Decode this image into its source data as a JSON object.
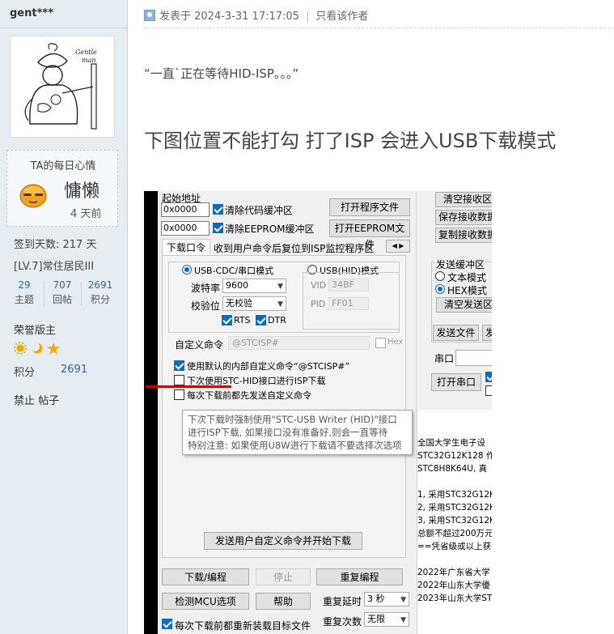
{
  "sidebar": {
    "username": "gent***",
    "mood_title": "TA的每日心情",
    "mood_label": "慵懒",
    "mood_days": "4 天前",
    "checkin_days": "签到天数: 217 天",
    "level": "[LV.7]常住居民III",
    "stats": [
      {
        "value": "29",
        "label": "主题"
      },
      {
        "value": "707",
        "label": "回帖"
      },
      {
        "value": "2691",
        "label": "积分"
      }
    ],
    "honor_title": "荣誉版主",
    "credit_label": "积分",
    "credit_value": "2691",
    "actions": "禁止 帖子",
    "avatar_caption": "Gentle man"
  },
  "post": {
    "posted_at": "发表于 2024-3-31 17:17:05",
    "only_author": "只看该作者",
    "quote": "“一直`正在等待HID-ISP。。。”",
    "headline": "下图位置不能打勾  打了ISP 会进入USB下载模式"
  },
  "shot": {
    "start_addr_label": "起始地址",
    "addr1": "0x0000",
    "addr2": "0x0000",
    "clear_code": "清除代码缓冲区",
    "clear_eeprom": "清除EEPROM缓冲区",
    "open_prog": "打开程序文件",
    "open_eeprom": "打开EEPROM文件",
    "tab_download": "下载口令",
    "tab_reset": "收到用户命令后复位到ISP监控程序区",
    "usb_cdc": "USB-CDC/串口模式",
    "usb_hid": "USB(HID)模式",
    "baud_label": "波特率",
    "baud_value": "9600",
    "parity_label": "校验位",
    "parity_value": "无校验",
    "rts": "RTS",
    "dtr": "DTR",
    "vid_label": "VID",
    "vid_value": "34BF",
    "pid_label": "PID",
    "pid_value": "FF01",
    "custom_cmd_label": "自定义命令",
    "custom_cmd_value": "@STCISP#",
    "hex_label": "Hex",
    "use_default": "使用默认的内部自定义命令“@STCISP#”",
    "next_hid": "下次使用STC-HID接口进行ISP下载",
    "send_each": "每次下载前都先发送自定义命令",
    "tooltip_1": "下次下载时强制使用\"STC-USB Writer (HID)\"接口",
    "tooltip_2": "进行ISP下载, 如果接口没有准备好,则会一直等待",
    "tooltip_3": "特别注意: 如果使用U8W进行下载请不要选择次选项",
    "send_and_download": "发送用户自定义命令并开始下载",
    "btn_download": "下载/编程",
    "btn_stop": "停止",
    "btn_reprogram": "重复编程",
    "btn_detect": "检测MCU选项",
    "btn_help": "帮助",
    "repeat_delay_label": "重复延时",
    "repeat_delay_value": "3 秒",
    "repeat_count_label": "重复次数",
    "repeat_count_value": "无限",
    "reload_each": "每次下载前都重新装载目标文件",
    "clear_recv": "清空接收区",
    "save_recv": "保存接收数据",
    "copy_recv": "复制接收数据",
    "send_buf": "发送缓冲区",
    "text_mode": "文本模式",
    "hex_mode": "HEX模式",
    "clear_send": "清空发送区",
    "send_file": "发送文件",
    "send_trunc": "发",
    "port_label": "串口",
    "open_port": "打开串口",
    "log": [
      "全国大学生电子设",
      "STC32G12K128 作",
      "STC8H8K64U, 真",
      "",
      "1, 采用STC32G12K",
      "2, 采用STC32G12K",
      "3, 采用STC32G12K",
      "总额不超过200万元",
      "==凭省级或以上获",
      "",
      "2022年广东省大学",
      "2022年山东大学優",
      "2023年山东大学ST"
    ]
  }
}
